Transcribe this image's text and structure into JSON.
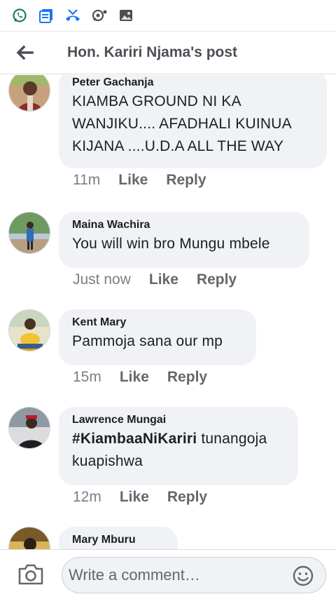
{
  "header": {
    "title": "Hon. Kariri Njama's post"
  },
  "comments": [
    {
      "author": "Peter Gachanja",
      "lines": [
        "KIAMBA GROUND NI KA",
        "WANJIKU.... AFADHALI KUINUA",
        "KIJANA ....U.D.A ALL THE WAY"
      ],
      "time": "11m",
      "like": "Like",
      "reply": "Reply"
    },
    {
      "author": "Maina Wachira",
      "lines": [
        "You will win bro Mungu mbele"
      ],
      "time": "Just now",
      "like": "Like",
      "reply": "Reply"
    },
    {
      "author": "Kent Mary",
      "lines": [
        "Pammoja sana our mp"
      ],
      "time": "15m",
      "like": "Like",
      "reply": "Reply"
    },
    {
      "author": "Lawrence Mungai",
      "hashtag": "#KiambaaNiKariri",
      "text_after_hashtag": " tunangoja",
      "lines": [
        "kuapishwa"
      ],
      "time": "12m",
      "like": "Like",
      "reply": "Reply"
    },
    {
      "author": "Mary Mburu"
    }
  ],
  "composer": {
    "placeholder": "Write a comment…"
  },
  "colors": {
    "bubble": "#f0f2f5",
    "meta_text": "#65676b",
    "whatsapp": "#25d366",
    "facebook_blue": "#1877f2"
  },
  "icons": [
    "whatsapp-icon",
    "document-icon",
    "missed-call-icon",
    "sync-icon",
    "image-icon",
    "back-arrow-icon",
    "camera-icon",
    "emoji-icon"
  ]
}
